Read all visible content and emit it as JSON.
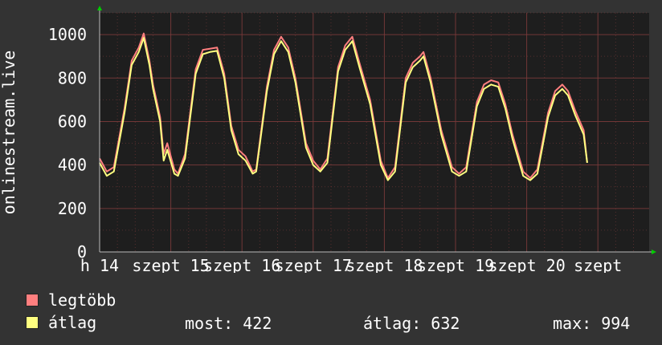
{
  "chart_data": {
    "type": "line",
    "ylabel": "onlinestream.live",
    "ylim": [
      0,
      1100
    ],
    "yticks": [
      0,
      200,
      400,
      600,
      800,
      1000
    ],
    "x_tick_labels": [
      "h 14",
      "szept",
      "15",
      "szept",
      "16",
      "szept",
      "17",
      "szept",
      "18",
      "szept",
      "19",
      "szept",
      "20",
      "szept"
    ],
    "day_labels": [
      "h 14",
      "szept 15",
      "szept 16",
      "szept 17",
      "szept 18",
      "szept 19",
      "szept 20",
      "szept"
    ],
    "x_range_days": [
      0,
      7.72
    ],
    "grid": true,
    "legend_position": "bottom-left",
    "series": [
      {
        "name": "legtöbb",
        "color": "#ff7f7f",
        "points": [
          [
            0.0,
            430
          ],
          [
            0.1,
            370
          ],
          [
            0.2,
            390
          ],
          [
            0.35,
            660
          ],
          [
            0.45,
            880
          ],
          [
            0.55,
            940
          ],
          [
            0.62,
            1005
          ],
          [
            0.7,
            880
          ],
          [
            0.75,
            770
          ],
          [
            0.85,
            620
          ],
          [
            0.9,
            450
          ],
          [
            0.95,
            500
          ],
          [
            1.05,
            380
          ],
          [
            1.1,
            360
          ],
          [
            1.2,
            450
          ],
          [
            1.35,
            840
          ],
          [
            1.45,
            930
          ],
          [
            1.55,
            935
          ],
          [
            1.65,
            940
          ],
          [
            1.75,
            820
          ],
          [
            1.85,
            580
          ],
          [
            1.95,
            470
          ],
          [
            2.05,
            440
          ],
          [
            2.15,
            370
          ],
          [
            2.2,
            380
          ],
          [
            2.35,
            760
          ],
          [
            2.45,
            930
          ],
          [
            2.55,
            990
          ],
          [
            2.65,
            940
          ],
          [
            2.75,
            800
          ],
          [
            2.9,
            500
          ],
          [
            3.0,
            420
          ],
          [
            3.1,
            380
          ],
          [
            3.2,
            430
          ],
          [
            3.35,
            850
          ],
          [
            3.45,
            950
          ],
          [
            3.55,
            990
          ],
          [
            3.65,
            870
          ],
          [
            3.8,
            700
          ],
          [
            3.95,
            420
          ],
          [
            4.05,
            340
          ],
          [
            4.15,
            390
          ],
          [
            4.3,
            800
          ],
          [
            4.4,
            870
          ],
          [
            4.5,
            900
          ],
          [
            4.55,
            920
          ],
          [
            4.65,
            800
          ],
          [
            4.8,
            560
          ],
          [
            4.95,
            390
          ],
          [
            5.05,
            360
          ],
          [
            5.15,
            390
          ],
          [
            5.3,
            690
          ],
          [
            5.4,
            770
          ],
          [
            5.5,
            790
          ],
          [
            5.6,
            780
          ],
          [
            5.7,
            680
          ],
          [
            5.8,
            540
          ],
          [
            5.95,
            370
          ],
          [
            6.05,
            340
          ],
          [
            6.15,
            380
          ],
          [
            6.3,
            640
          ],
          [
            6.4,
            740
          ],
          [
            6.5,
            770
          ],
          [
            6.58,
            740
          ],
          [
            6.68,
            650
          ],
          [
            6.8,
            560
          ],
          [
            6.85,
            410
          ]
        ]
      },
      {
        "name": "átlag",
        "color": "#ffff80",
        "points": [
          [
            0.0,
            410
          ],
          [
            0.1,
            350
          ],
          [
            0.2,
            370
          ],
          [
            0.35,
            640
          ],
          [
            0.45,
            860
          ],
          [
            0.55,
            920
          ],
          [
            0.62,
            985
          ],
          [
            0.7,
            860
          ],
          [
            0.75,
            750
          ],
          [
            0.85,
            600
          ],
          [
            0.9,
            420
          ],
          [
            0.95,
            470
          ],
          [
            1.05,
            360
          ],
          [
            1.1,
            350
          ],
          [
            1.2,
            430
          ],
          [
            1.35,
            820
          ],
          [
            1.45,
            910
          ],
          [
            1.55,
            920
          ],
          [
            1.65,
            925
          ],
          [
            1.75,
            800
          ],
          [
            1.85,
            560
          ],
          [
            1.95,
            450
          ],
          [
            2.05,
            420
          ],
          [
            2.15,
            360
          ],
          [
            2.2,
            370
          ],
          [
            2.35,
            740
          ],
          [
            2.45,
            910
          ],
          [
            2.55,
            970
          ],
          [
            2.65,
            920
          ],
          [
            2.75,
            780
          ],
          [
            2.9,
            480
          ],
          [
            3.0,
            400
          ],
          [
            3.1,
            370
          ],
          [
            3.2,
            410
          ],
          [
            3.35,
            830
          ],
          [
            3.45,
            930
          ],
          [
            3.55,
            970
          ],
          [
            3.65,
            850
          ],
          [
            3.8,
            680
          ],
          [
            3.95,
            400
          ],
          [
            4.05,
            330
          ],
          [
            4.15,
            370
          ],
          [
            4.3,
            780
          ],
          [
            4.4,
            850
          ],
          [
            4.5,
            880
          ],
          [
            4.55,
            900
          ],
          [
            4.65,
            780
          ],
          [
            4.8,
            540
          ],
          [
            4.95,
            370
          ],
          [
            5.05,
            350
          ],
          [
            5.15,
            370
          ],
          [
            5.3,
            670
          ],
          [
            5.4,
            750
          ],
          [
            5.5,
            770
          ],
          [
            5.6,
            760
          ],
          [
            5.7,
            660
          ],
          [
            5.8,
            520
          ],
          [
            5.95,
            350
          ],
          [
            6.05,
            330
          ],
          [
            6.15,
            360
          ],
          [
            6.3,
            620
          ],
          [
            6.4,
            720
          ],
          [
            6.5,
            750
          ],
          [
            6.58,
            720
          ],
          [
            6.68,
            630
          ],
          [
            6.8,
            540
          ],
          [
            6.85,
            410
          ]
        ]
      }
    ]
  },
  "legend": [
    {
      "label": "legtöbb",
      "color": "#ff7f7f"
    },
    {
      "label": "átlag",
      "color": "#ffff80"
    }
  ],
  "stats": {
    "most": "most: 422",
    "atlag": "átlag: 632",
    "max": "max: 994"
  },
  "colors": {
    "background": "#333333",
    "plot_background": "#1e1e1e",
    "grid": "#7a3a3a",
    "axis_arrow": "#00cc00",
    "text": "#ffffff"
  }
}
